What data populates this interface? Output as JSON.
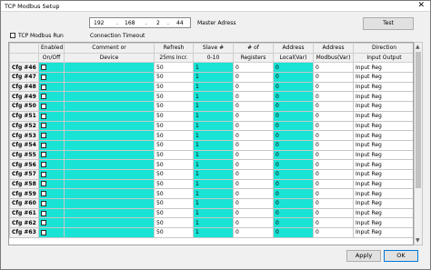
{
  "window": {
    "title": "TCP Modbus Setup",
    "close_glyph": "✕"
  },
  "ip": {
    "octet1": "192",
    "octet2": "168",
    "octet3": "2",
    "octet4": "44",
    "dot": "."
  },
  "labels": {
    "master_address": "Master Adress",
    "run": "TCP Modbus Run",
    "timeout": "Connection Timeout"
  },
  "buttons": {
    "test": "Test",
    "apply": "Apply",
    "ok": "OK"
  },
  "header_row1": [
    "",
    "Enabled",
    "Comment or",
    "Refresh",
    "Slave #",
    "# of",
    "Address",
    "Address",
    "Direction"
  ],
  "header_row2": [
    "",
    "On/Off",
    "Device",
    "25ms Incr.",
    "0-10",
    "Registers",
    "Local(Var)",
    "Modbus(Var)",
    "Input Output"
  ],
  "rows": [
    {
      "id": "Cfg #46",
      "refresh": "50",
      "slave": "1",
      "registers": "0",
      "local": "0",
      "modbus": "0",
      "direction": "Input Reg"
    },
    {
      "id": "Cfg #47",
      "refresh": "50",
      "slave": "1",
      "registers": "0",
      "local": "0",
      "modbus": "0",
      "direction": "Input Reg"
    },
    {
      "id": "Cfg #48",
      "refresh": "50",
      "slave": "1",
      "registers": "0",
      "local": "0",
      "modbus": "0",
      "direction": "Input Reg"
    },
    {
      "id": "Cfg #49",
      "refresh": "50",
      "slave": "1",
      "registers": "0",
      "local": "0",
      "modbus": "0",
      "direction": "Input Reg"
    },
    {
      "id": "Cfg #50",
      "refresh": "50",
      "slave": "1",
      "registers": "0",
      "local": "0",
      "modbus": "0",
      "direction": "Input Reg"
    },
    {
      "id": "Cfg #51",
      "refresh": "50",
      "slave": "1",
      "registers": "0",
      "local": "0",
      "modbus": "0",
      "direction": "Input Reg"
    },
    {
      "id": "Cfg #52",
      "refresh": "50",
      "slave": "1",
      "registers": "0",
      "local": "0",
      "modbus": "0",
      "direction": "Input Reg"
    },
    {
      "id": "Cfg #53",
      "refresh": "50",
      "slave": "1",
      "registers": "0",
      "local": "0",
      "modbus": "0",
      "direction": "Input Reg"
    },
    {
      "id": "Cfg #54",
      "refresh": "50",
      "slave": "1",
      "registers": "0",
      "local": "0",
      "modbus": "0",
      "direction": "Input Reg"
    },
    {
      "id": "Cfg #55",
      "refresh": "50",
      "slave": "1",
      "registers": "0",
      "local": "0",
      "modbus": "0",
      "direction": "Input Reg"
    },
    {
      "id": "Cfg #56",
      "refresh": "50",
      "slave": "1",
      "registers": "0",
      "local": "0",
      "modbus": "0",
      "direction": "Input Reg"
    },
    {
      "id": "Cfg #57",
      "refresh": "50",
      "slave": "1",
      "registers": "0",
      "local": "0",
      "modbus": "0",
      "direction": "Input Reg"
    },
    {
      "id": "Cfg #58",
      "refresh": "50",
      "slave": "1",
      "registers": "0",
      "local": "0",
      "modbus": "0",
      "direction": "Input Reg"
    },
    {
      "id": "Cfg #59",
      "refresh": "50",
      "slave": "1",
      "registers": "0",
      "local": "0",
      "modbus": "0",
      "direction": "Input Reg"
    },
    {
      "id": "Cfg #60",
      "refresh": "50",
      "slave": "1",
      "registers": "0",
      "local": "0",
      "modbus": "0",
      "direction": "Input Reg"
    },
    {
      "id": "Cfg #61",
      "refresh": "50",
      "slave": "1",
      "registers": "0",
      "local": "0",
      "modbus": "0",
      "direction": "Input Reg"
    },
    {
      "id": "Cfg #62",
      "refresh": "50",
      "slave": "1",
      "registers": "0",
      "local": "0",
      "modbus": "0",
      "direction": "Input Reg"
    },
    {
      "id": "Cfg #63",
      "refresh": "50",
      "slave": "1",
      "registers": "0",
      "local": "0",
      "modbus": "0",
      "direction": "Input Reg"
    }
  ],
  "colors": {
    "highlight": "#19e3d5"
  },
  "scroll": {
    "up_glyph": "▲",
    "down_glyph": "▼"
  }
}
